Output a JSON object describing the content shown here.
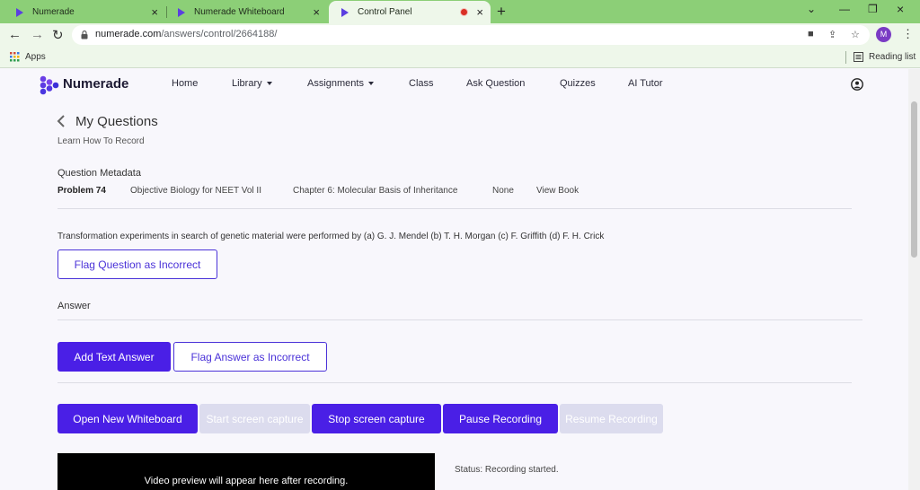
{
  "browser": {
    "tabs": [
      {
        "title": "Numerade",
        "active": false
      },
      {
        "title": "Numerade Whiteboard",
        "active": false
      },
      {
        "title": "Control Panel",
        "active": true,
        "recording": true
      }
    ],
    "url": {
      "host": "numerade.com",
      "path": "/answers/control/2664188/"
    },
    "profile_initial": "M",
    "bookmarks": {
      "apps_label": "Apps",
      "reading_list_label": "Reading list"
    },
    "colors": {
      "tab_strip": "#8ccf77",
      "toolbar": "#eef7ea"
    }
  },
  "site": {
    "brand": "Numerade",
    "nav": [
      {
        "label": "Home",
        "dropdown": false
      },
      {
        "label": "Library",
        "dropdown": true
      },
      {
        "label": "Assignments",
        "dropdown": true
      },
      {
        "label": "Class",
        "dropdown": false
      },
      {
        "label": "Ask Question",
        "dropdown": false
      },
      {
        "label": "Quizzes",
        "dropdown": false
      },
      {
        "label": "AI Tutor",
        "dropdown": false
      }
    ]
  },
  "page": {
    "title": "My Questions",
    "learn_link": "Learn How To Record",
    "metadata": {
      "heading": "Question Metadata",
      "problem": "Problem 74",
      "book": "Objective Biology for NEET Vol II",
      "chapter": "Chapter 6: Molecular Basis of Inheritance",
      "section": "None",
      "view_book": "View Book"
    },
    "question_text": "Transformation experiments in search of genetic material were performed by (a) G. J. Mendel (b) T. H. Morgan (c) F. Griffith (d) F. H. Crick",
    "flag_question_label": "Flag Question as Incorrect",
    "answer_heading": "Answer",
    "add_text_answer_label": "Add Text Answer",
    "flag_answer_label": "Flag Answer as Incorrect",
    "recording_controls": {
      "open_whiteboard": "Open New Whiteboard",
      "start_capture": "Start screen capture",
      "stop_capture": "Stop screen capture",
      "pause_recording": "Pause Recording",
      "resume_recording": "Resume Recording"
    },
    "video_placeholder": "Video preview will appear here after recording.",
    "status": "Status: Recording started."
  },
  "colors": {
    "accent": "#4a1fe6",
    "disabled_button": "#dcdcee"
  }
}
